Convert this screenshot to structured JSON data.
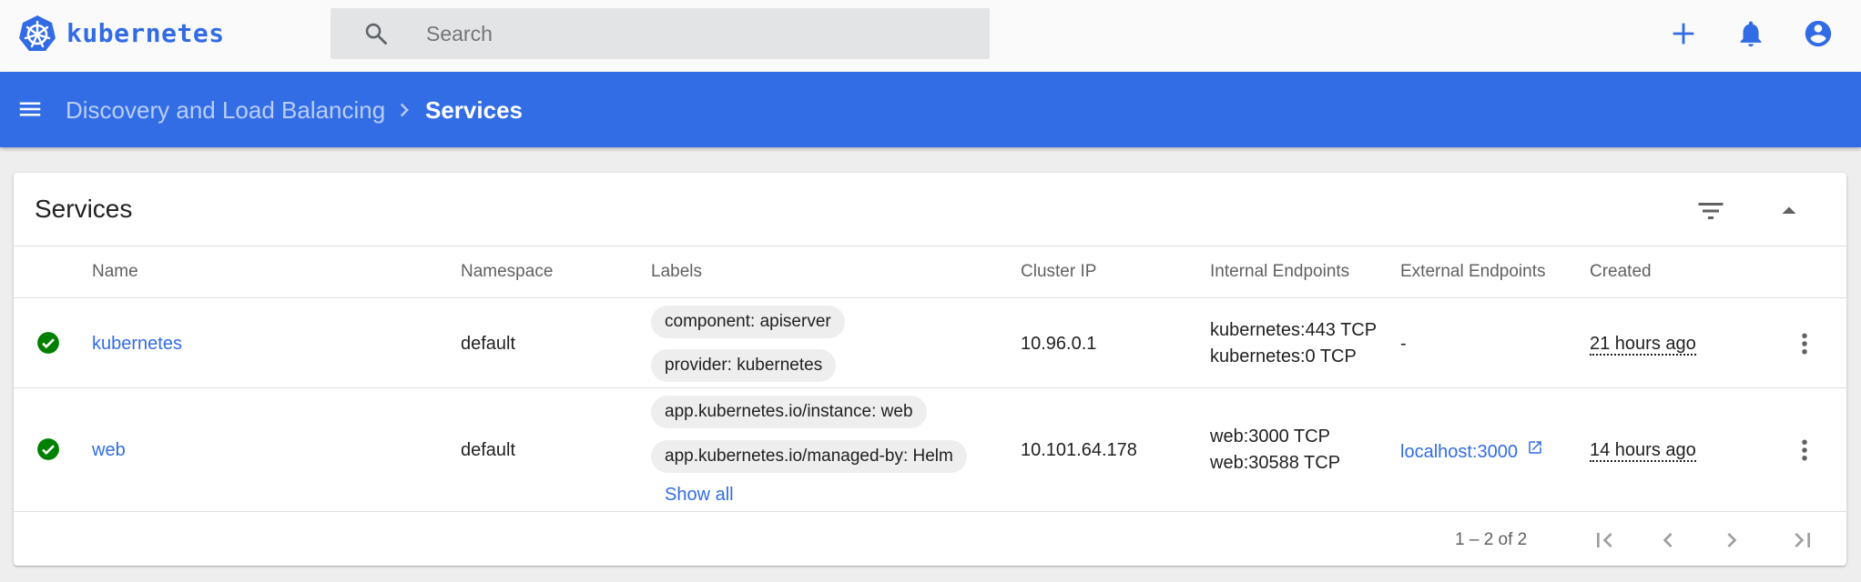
{
  "app": {
    "brand": "kubernetes",
    "brand_color": "#326ce5",
    "logo_icon": "kubernetes-helm-wheel-logo"
  },
  "search": {
    "placeholder": "Search",
    "value": "",
    "icon": "search-icon"
  },
  "topbar_actions": [
    {
      "name": "create",
      "icon": "plus-icon"
    },
    {
      "name": "notifications",
      "icon": "bell-icon"
    },
    {
      "name": "account",
      "icon": "account-circle-icon"
    }
  ],
  "breadcrumb": {
    "parent": "Discovery and Load Balancing",
    "current": "Services",
    "separator_icon": "chevron-right-icon"
  },
  "colors": {
    "nav_bg": "#326de6",
    "status_ok": "#008000",
    "link": "#326ce5"
  },
  "card": {
    "title": "Services",
    "filter_icon": "filter-list-icon",
    "collapse_icon": "arrow-drop-up-icon"
  },
  "table": {
    "columns": [
      "Name",
      "Namespace",
      "Labels",
      "Cluster IP",
      "Internal Endpoints",
      "External Endpoints",
      "Created"
    ],
    "rows": [
      {
        "status": "check-circle-icon",
        "name": "kubernetes",
        "namespace": "default",
        "labels": [
          "component: apiserver",
          "provider: kubernetes"
        ],
        "cluster_ip": "10.96.0.1",
        "internal_endpoints": [
          "kubernetes:443 TCP",
          "kubernetes:0 TCP"
        ],
        "external_endpoints": "-",
        "created": "21 hours ago"
      },
      {
        "status": "check-circle-icon",
        "name": "web",
        "namespace": "default",
        "labels": [
          "app.kubernetes.io/instance: web",
          "app.kubernetes.io/managed-by: Helm"
        ],
        "show_all": "Show all",
        "cluster_ip": "10.101.64.178",
        "internal_endpoints": [
          "web:3000 TCP",
          "web:30588 TCP"
        ],
        "external_endpoints": "localhost:3000",
        "external_icon": "open-in-new-icon",
        "created": "14 hours ago"
      }
    ]
  },
  "pagination": {
    "range": "1 – 2 of 2",
    "buttons": [
      "first-page-icon",
      "chevron-left-icon",
      "chevron-right-icon",
      "last-page-icon"
    ]
  }
}
